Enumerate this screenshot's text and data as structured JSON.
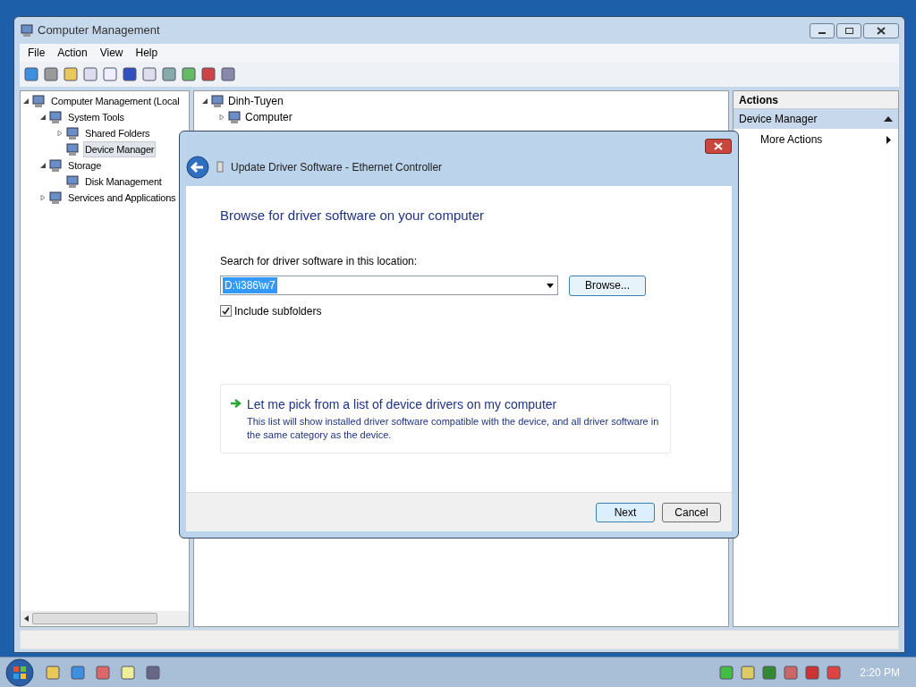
{
  "window": {
    "title": "Computer Management"
  },
  "menu": [
    "File",
    "Action",
    "View",
    "Help"
  ],
  "tree": [
    {
      "label": "Computer Management (Local",
      "expanded": true,
      "selected": false,
      "children": [
        {
          "label": "System Tools",
          "expanded": true,
          "selected": false,
          "children": [
            {
              "label": "Shared Folders",
              "expanded": false,
              "selected": false
            },
            {
              "label": "Device Manager",
              "selected": true
            }
          ]
        },
        {
          "label": "Storage",
          "expanded": true,
          "selected": false,
          "children": [
            {
              "label": "Disk Management",
              "selected": false
            }
          ]
        },
        {
          "label": "Services and Applications",
          "expanded": false,
          "selected": false
        }
      ]
    }
  ],
  "device_tree": [
    {
      "label": "Dinh-Tuyen",
      "expanded": true,
      "children": [
        {
          "label": "Computer",
          "expanded": false
        }
      ]
    }
  ],
  "actions": {
    "header": "Actions",
    "section": {
      "label": "Device Manager",
      "expanded": true
    },
    "items": [
      "More Actions"
    ]
  },
  "dialog": {
    "title": "Update Driver Software - Ethernet Controller",
    "heading": "Browse for driver software on your computer",
    "location_label": "Search for driver software in this location:",
    "location_value": "D:\\i386\\w7",
    "browse_button": "Browse...",
    "include_subfolders": {
      "label": "Include subfolders",
      "checked": true
    },
    "option": {
      "title": "Let me pick from a list of device drivers on my computer",
      "description": "This list will show installed driver software compatible with the device, and all driver software in the same category as the device."
    },
    "buttons": [
      {
        "label": "Next",
        "default": true
      },
      {
        "label": "Cancel",
        "default": false
      }
    ]
  },
  "taskbar": {
    "clock": "2:20 PM"
  }
}
